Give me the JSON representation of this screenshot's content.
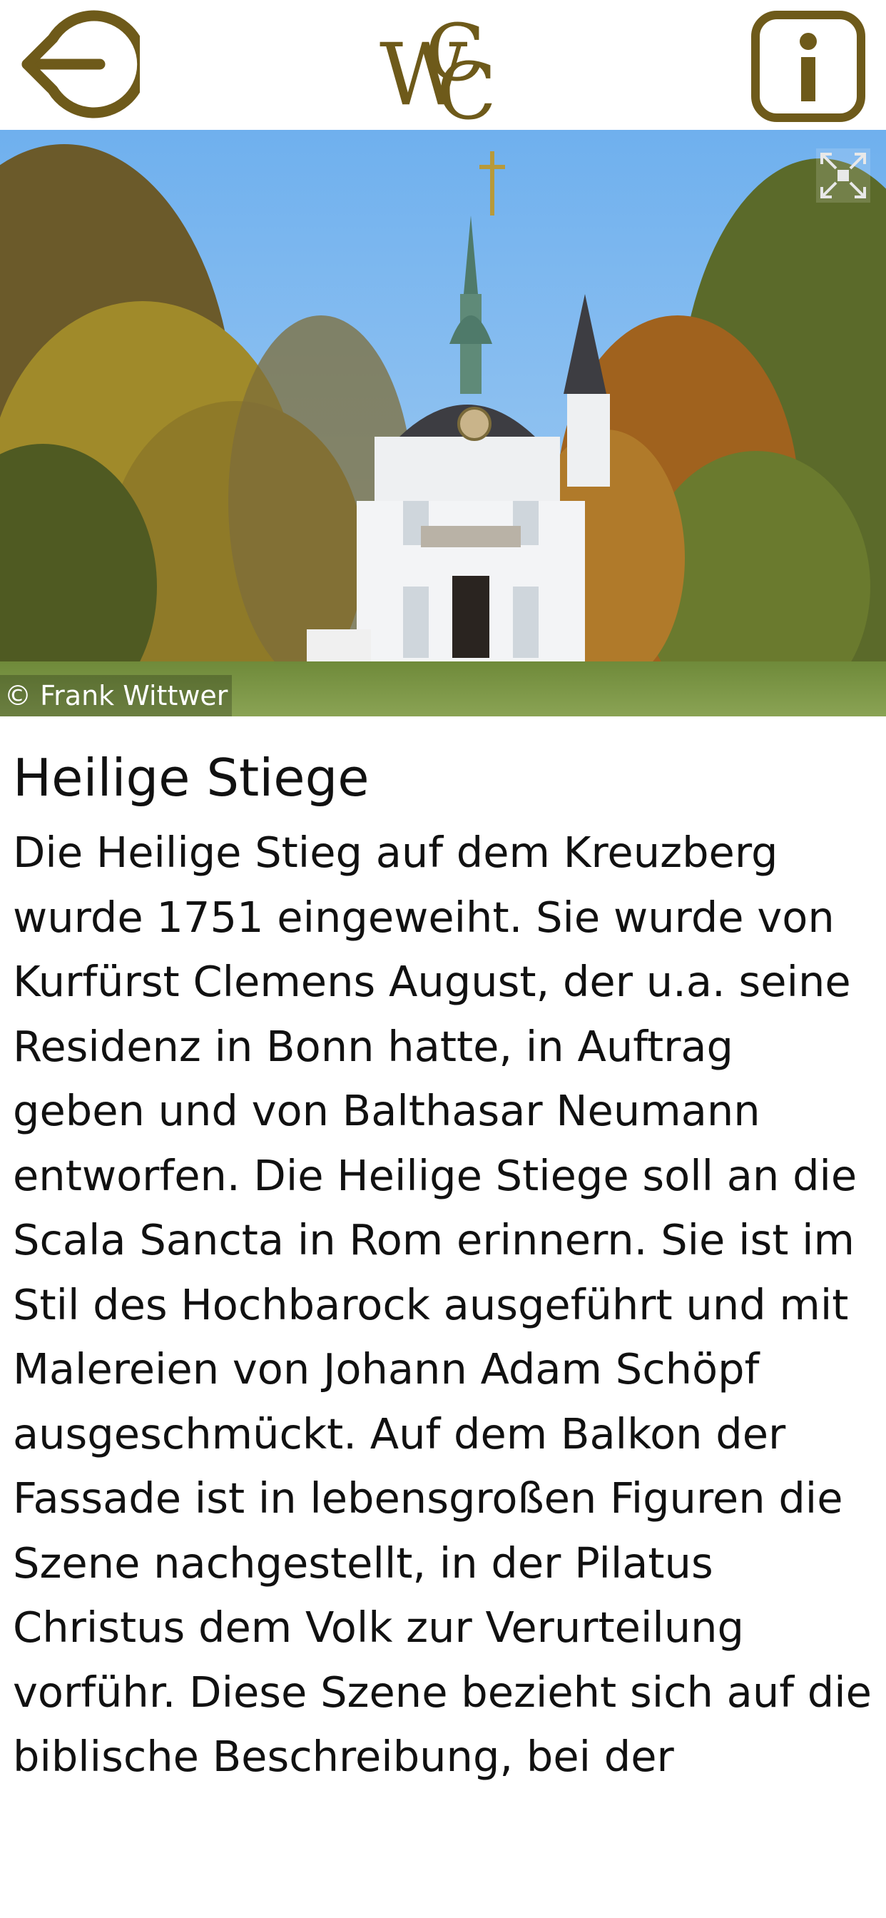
{
  "header": {
    "back_icon": "back-arrow-circle-icon",
    "logo_text": "WCC",
    "info_label": "i",
    "accent_color": "#6e5a1a"
  },
  "hero": {
    "credit": "© Frank Wittwer",
    "expand_icon": "fullscreen-expand-icon"
  },
  "article": {
    "title": "Heilige Stiege",
    "body": "Die Heilige Stieg auf dem Kreuzberg wurde 1751 eingeweiht. Sie wurde von Kurfürst Clemens August, der u.a. seine Residenz in Bonn hatte, in Auftrag geben und von Balthasar Neumann entworfen. Die Heilige Stiege soll an die Scala Sancta in Rom erinnern. Sie ist im Stil des Hochbarock ausgeführt und mit Malereien von Johann Adam Schöpf ausgeschmückt. Auf dem Balkon der Fassade ist in lebensgroßen Figuren die Szene nachgestellt, in der Pilatus Christus dem Volk zur Verurteilung vorführ. Diese Szene bezieht sich auf die biblische Beschreibung, bei der"
  }
}
